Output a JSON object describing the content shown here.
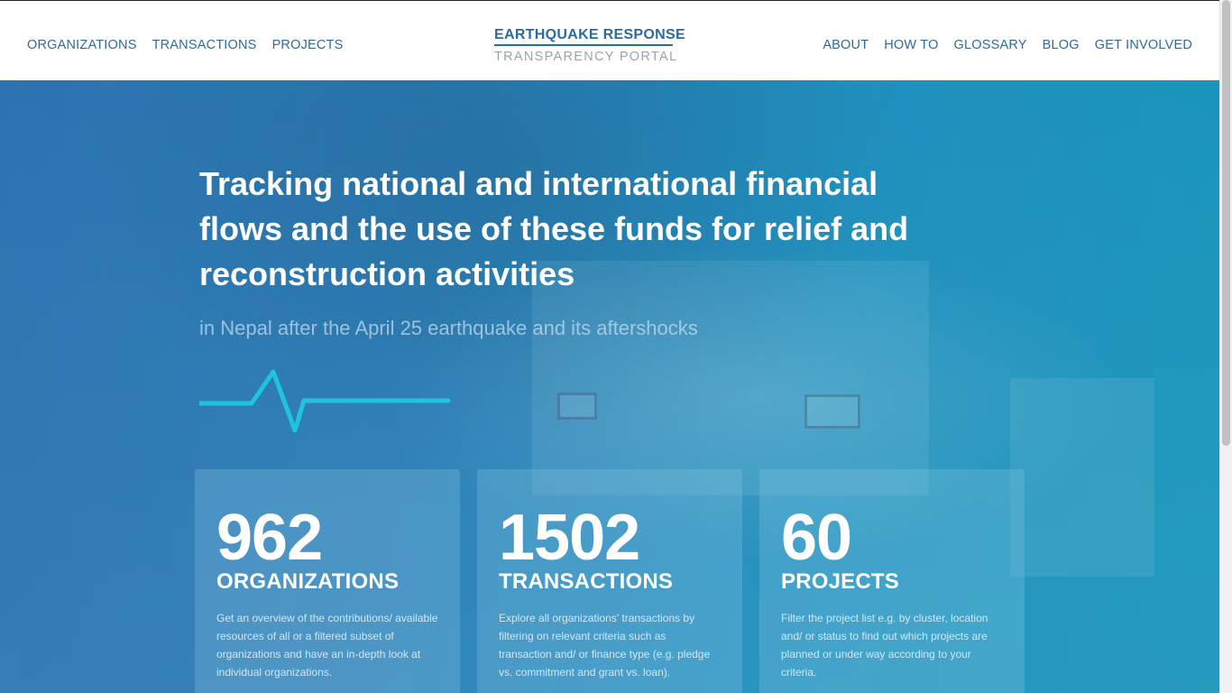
{
  "header": {
    "nav_left": [
      "ORGANIZATIONS",
      "TRANSACTIONS",
      "PROJECTS"
    ],
    "brand_title": "EARTHQUAKE RESPONSE",
    "brand_subtitle": "TRANSPARENCY PORTAL",
    "nav_right": [
      "ABOUT",
      "HOW TO",
      "GLOSSARY",
      "BLOG",
      "GET INVOLVED"
    ]
  },
  "hero": {
    "headline": "Tracking national and international financial flows and the use of these funds for relief and reconstruction activities",
    "subline": "in Nepal after the April 25 earthquake and its aftershocks",
    "pulse_icon": "heartbeat-line",
    "pulse_color": "#1fc3e0"
  },
  "cards": [
    {
      "number": "962",
      "label": "ORGANIZATIONS",
      "description": "Get an overview of the contributions/ available resources of all or a filtered subset of organizations and have an in-depth look at individual organizations."
    },
    {
      "number": "1502",
      "label": "TRANSACTIONS",
      "description": "Explore all organizations' transactions by filtering on relevant criteria such as transaction and/ or finance type (e.g. pledge vs. commitment and grant vs. loan)."
    },
    {
      "number": "60",
      "label": "PROJECTS",
      "description": "Filter the project list e.g. by cluster, location and/ or status to find out which projects are planned or under way according to your criteria."
    }
  ],
  "colors": {
    "nav_text": "#2e6a9e",
    "brand_sub": "#9aa4ad",
    "hero_start": "#2c73b0",
    "hero_end": "#1996bb"
  }
}
